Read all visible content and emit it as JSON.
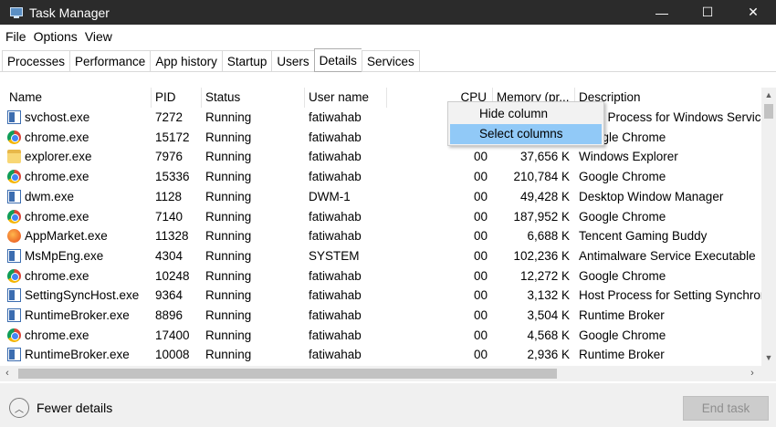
{
  "window": {
    "title": "Task Manager",
    "minimize": "—",
    "maximize": "☐",
    "close": "✕"
  },
  "menu": [
    "File",
    "Options",
    "View"
  ],
  "tabs": [
    "Processes",
    "Performance",
    "App history",
    "Startup",
    "Users",
    "Details",
    "Services"
  ],
  "active_tab": "Details",
  "columns": {
    "name": "Name",
    "pid": "PID",
    "status": "Status",
    "user": "User name",
    "cpu": "CPU",
    "memory": "Memory (pr...",
    "description": "Description"
  },
  "rows": [
    {
      "icon": "service-icon",
      "name": "svchost.exe",
      "pid": "7272",
      "status": "Running",
      "user": "fatiwahab",
      "cpu": "00",
      "memory": "",
      "description": "Host Process for Windows Services"
    },
    {
      "icon": "chrome-icon",
      "name": "chrome.exe",
      "pid": "15172",
      "status": "Running",
      "user": "fatiwahab",
      "cpu": "00",
      "memory": "",
      "description": "Google Chrome"
    },
    {
      "icon": "folder-icon",
      "name": "explorer.exe",
      "pid": "7976",
      "status": "Running",
      "user": "fatiwahab",
      "cpu": "00",
      "memory": "37,656 K",
      "description": "Windows Explorer"
    },
    {
      "icon": "chrome-icon",
      "name": "chrome.exe",
      "pid": "15336",
      "status": "Running",
      "user": "fatiwahab",
      "cpu": "00",
      "memory": "210,784 K",
      "description": "Google Chrome"
    },
    {
      "icon": "service-icon",
      "name": "dwm.exe",
      "pid": "1128",
      "status": "Running",
      "user": "DWM-1",
      "cpu": "00",
      "memory": "49,428 K",
      "description": "Desktop Window Manager"
    },
    {
      "icon": "chrome-icon",
      "name": "chrome.exe",
      "pid": "7140",
      "status": "Running",
      "user": "fatiwahab",
      "cpu": "00",
      "memory": "187,952 K",
      "description": "Google Chrome"
    },
    {
      "icon": "appmarket-icon",
      "name": "AppMarket.exe",
      "pid": "11328",
      "status": "Running",
      "user": "fatiwahab",
      "cpu": "00",
      "memory": "6,688 K",
      "description": "Tencent Gaming Buddy"
    },
    {
      "icon": "service-icon",
      "name": "MsMpEng.exe",
      "pid": "4304",
      "status": "Running",
      "user": "SYSTEM",
      "cpu": "00",
      "memory": "102,236 K",
      "description": "Antimalware Service Executable"
    },
    {
      "icon": "chrome-icon",
      "name": "chrome.exe",
      "pid": "10248",
      "status": "Running",
      "user": "fatiwahab",
      "cpu": "00",
      "memory": "12,272 K",
      "description": "Google Chrome"
    },
    {
      "icon": "service-icon",
      "name": "SettingSyncHost.exe",
      "pid": "9364",
      "status": "Running",
      "user": "fatiwahab",
      "cpu": "00",
      "memory": "3,132 K",
      "description": "Host Process for Setting Synchronization"
    },
    {
      "icon": "service-icon",
      "name": "RuntimeBroker.exe",
      "pid": "8896",
      "status": "Running",
      "user": "fatiwahab",
      "cpu": "00",
      "memory": "3,504 K",
      "description": "Runtime Broker"
    },
    {
      "icon": "chrome-icon",
      "name": "chrome.exe",
      "pid": "17400",
      "status": "Running",
      "user": "fatiwahab",
      "cpu": "00",
      "memory": "4,568 K",
      "description": "Google Chrome"
    },
    {
      "icon": "service-icon",
      "name": "RuntimeBroker.exe",
      "pid": "10008",
      "status": "Running",
      "user": "fatiwahab",
      "cpu": "00",
      "memory": "2,936 K",
      "description": "Runtime Broker"
    }
  ],
  "context_menu": {
    "items": [
      "Hide column",
      "Select columns"
    ],
    "highlighted": "Select columns"
  },
  "footer": {
    "fewer_details": "Fewer details",
    "end_task": "End task"
  }
}
